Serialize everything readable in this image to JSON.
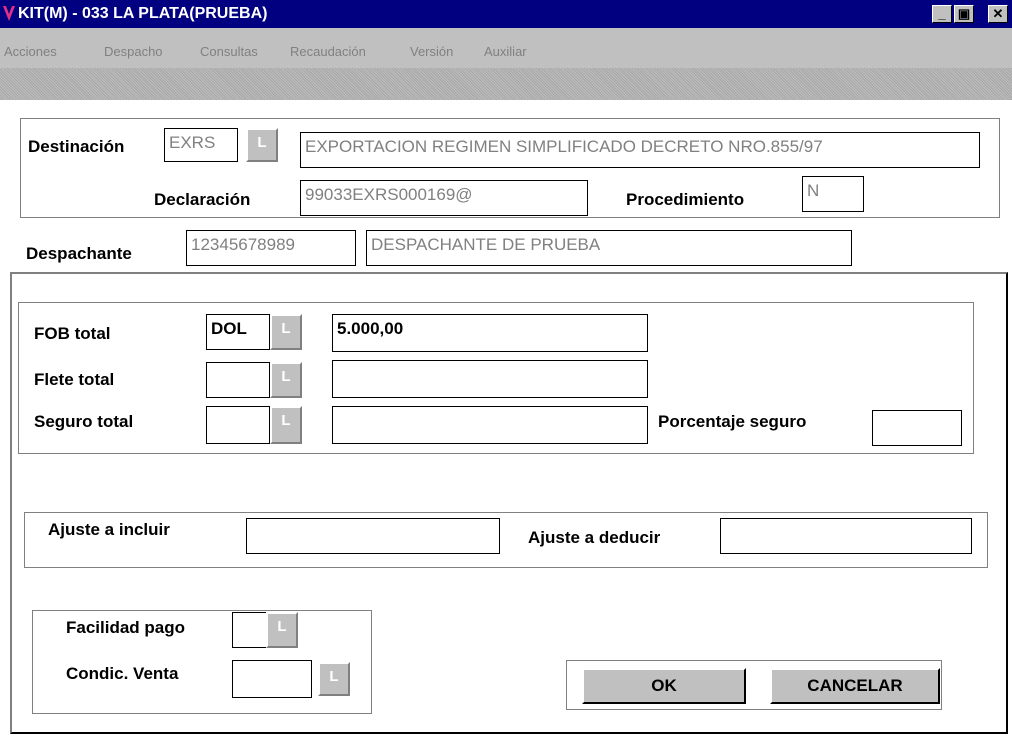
{
  "window": {
    "title": "KIT(M) - 033 LA PLATA(PRUEBA)",
    "minimize": "_",
    "restore": "▣",
    "close": "✕"
  },
  "menu": {
    "items": [
      "Acciones",
      "Despacho",
      "Consultas",
      "Recaudación",
      "Versión",
      "Auxiliar"
    ]
  },
  "header": {
    "destinacion_label": "Destinación",
    "destinacion_code": "EXRS",
    "destinacion_desc": "EXPORTACION REGIMEN SIMPLIFICADO DECRETO NRO.855/97",
    "declaracion_label": "Declaración",
    "declaracion_value": "99033EXRS000169@",
    "procedimiento_label": "Procedimiento",
    "procedimiento_value": "N",
    "despachante_label": "Despachante",
    "despachante_code": "12345678989",
    "despachante_name": "DESPACHANTE DE PRUEBA"
  },
  "lookup_label": "L",
  "totals": {
    "fob_label": "FOB total",
    "fob_currency": "DOL",
    "fob_value": "5.000,00",
    "flete_label": "Flete total",
    "flete_currency": "",
    "flete_value": "",
    "seguro_label": "Seguro total",
    "seguro_currency": "",
    "seguro_value": "",
    "porcentaje_label": "Porcentaje seguro",
    "porcentaje_value": ""
  },
  "ajustes": {
    "incluir_label": "Ajuste a incluir",
    "incluir_value": "",
    "deducir_label": "Ajuste a deducir",
    "deducir_value": ""
  },
  "pago": {
    "facilidad_label": "Facilidad pago",
    "facilidad_value": "",
    "condic_label": "Condic. Venta",
    "condic_value": ""
  },
  "buttons": {
    "ok": "OK",
    "cancel": "CANCELAR"
  },
  "colors": {
    "titlebar": "#000080",
    "chrome": "#c0c0c0",
    "icon": "#e03088"
  }
}
